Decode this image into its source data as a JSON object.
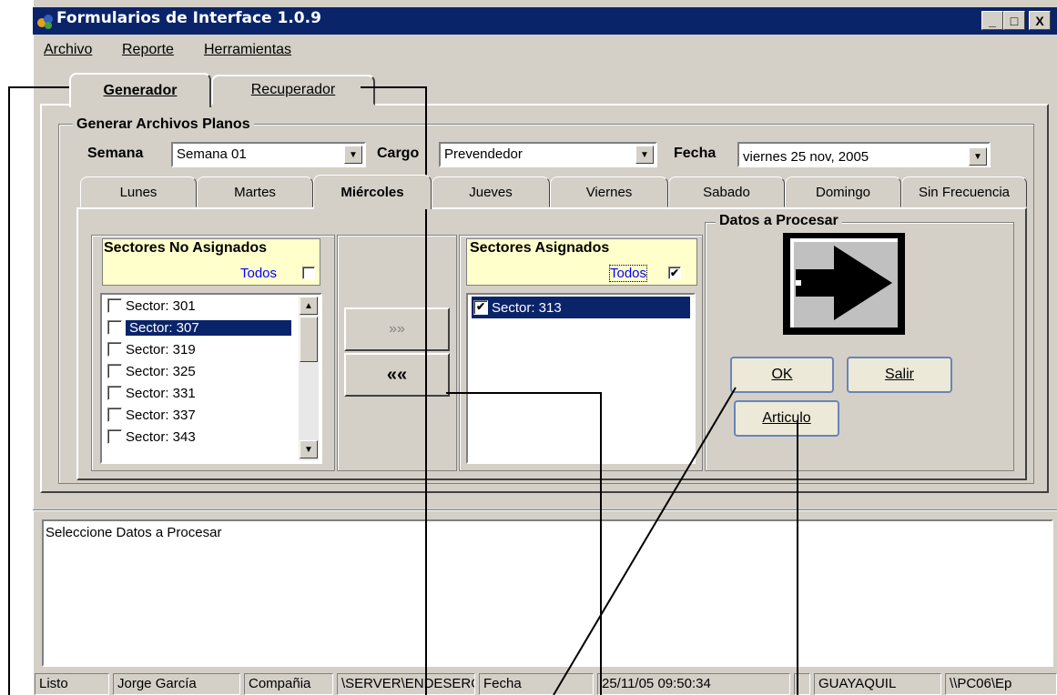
{
  "window": {
    "title": "Formularios de Interface 1.0.9",
    "caption_buttons": [
      "_",
      "□",
      "X"
    ],
    "title_color": "#0a246a"
  },
  "menu": [
    {
      "label": "Archivo"
    },
    {
      "label": "Reporte"
    },
    {
      "label": "Herramientas"
    }
  ],
  "main_tabs": [
    {
      "label": "Generador",
      "active": true
    },
    {
      "label": "Recuperador",
      "active": false
    }
  ],
  "group": {
    "title": "Generar Archivos Planos",
    "semana_label": "Semana",
    "semana_value": "Semana 01",
    "cargo_label": "Cargo",
    "cargo_value": "Prevendedor",
    "fecha_label": "Fecha",
    "fecha_value": "viernes  25  nov, 2005"
  },
  "day_tabs": [
    {
      "label": "Lunes",
      "active": false
    },
    {
      "label": "Martes",
      "active": false
    },
    {
      "label": "Miércoles",
      "active": true
    },
    {
      "label": "Jueves",
      "active": false
    },
    {
      "label": "Viernes",
      "active": false
    },
    {
      "label": "Sabado",
      "active": false
    },
    {
      "label": "Domingo",
      "active": false
    },
    {
      "label": "Sin Frecuencia",
      "active": false
    }
  ],
  "unassigned": {
    "title": "Sectores No Asignados",
    "todos_label": "Todos",
    "todos_checked": false,
    "items": [
      {
        "label": "Sector: 301",
        "checked": false,
        "selected": false
      },
      {
        "label": "Sector: 307",
        "checked": false,
        "selected": true
      },
      {
        "label": "Sector: 319",
        "checked": false,
        "selected": false
      },
      {
        "label": "Sector: 325",
        "checked": false,
        "selected": false
      },
      {
        "label": "Sector: 331",
        "checked": false,
        "selected": false
      },
      {
        "label": "Sector: 337",
        "checked": false,
        "selected": false
      },
      {
        "label": "Sector: 343",
        "checked": false,
        "selected": false
      }
    ]
  },
  "transfer": {
    "add_label": "»»",
    "remove_label": "««"
  },
  "assigned": {
    "title": "Sectores Asignados",
    "todos_label": "Todos",
    "todos_checked": true,
    "items": [
      {
        "label": "Sector: 313",
        "checked": true,
        "selected": true
      }
    ]
  },
  "process": {
    "title": "Datos a Procesar",
    "ok_label": "OK",
    "salir_label": "Salir",
    "articulo_label": "Articulo"
  },
  "message": "Seleccione Datos a Procesar",
  "statusbar": [
    "Listo",
    "Jorge García",
    "Compañia",
    "\\SERVER\\ENDESERO!",
    "Fecha",
    "25/11/05 09:50:34",
    "",
    "GUAYAQUIL",
    "\\\\PC06\\Ep"
  ]
}
